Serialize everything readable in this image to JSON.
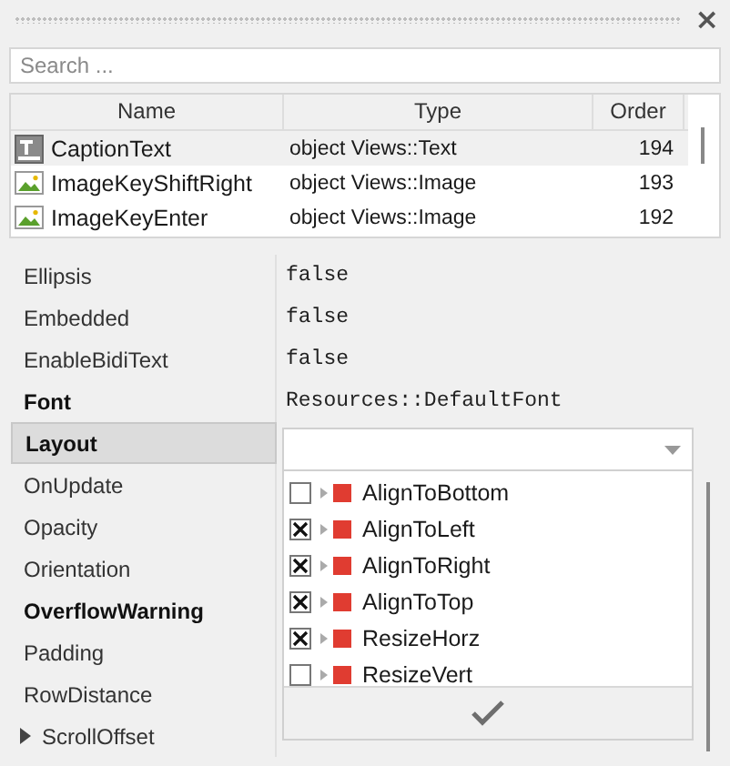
{
  "panel": {
    "close": "×"
  },
  "search": {
    "placeholder": "Search ..."
  },
  "table": {
    "columns": [
      "Name",
      "Type",
      "Order"
    ],
    "rows": [
      {
        "kind": "text",
        "name": "CaptionText",
        "type": "object Views::Text",
        "order": "194",
        "selected": true
      },
      {
        "kind": "image",
        "name": "ImageKeyShiftRight",
        "type": "object Views::Image",
        "order": "193",
        "selected": false
      },
      {
        "kind": "image",
        "name": "ImageKeyEnter",
        "type": "object Views::Image",
        "order": "192",
        "selected": false
      }
    ]
  },
  "properties": [
    {
      "name": "Ellipsis",
      "bold": false,
      "selected": false,
      "expandable": false,
      "value": "false"
    },
    {
      "name": "Embedded",
      "bold": false,
      "selected": false,
      "expandable": false,
      "value": "false"
    },
    {
      "name": "EnableBidiText",
      "bold": false,
      "selected": false,
      "expandable": false,
      "value": "false"
    },
    {
      "name": "Font",
      "bold": true,
      "selected": false,
      "expandable": false,
      "value": "Resources::DefaultFont"
    },
    {
      "name": "Layout",
      "bold": true,
      "selected": true,
      "expandable": false
    },
    {
      "name": "OnUpdate",
      "bold": false,
      "selected": false,
      "expandable": false
    },
    {
      "name": "Opacity",
      "bold": false,
      "selected": false,
      "expandable": false
    },
    {
      "name": "Orientation",
      "bold": false,
      "selected": false,
      "expandable": false
    },
    {
      "name": "OverflowWarning",
      "bold": true,
      "selected": false,
      "expandable": false
    },
    {
      "name": "Padding",
      "bold": false,
      "selected": false,
      "expandable": false
    },
    {
      "name": "RowDistance",
      "bold": false,
      "selected": false,
      "expandable": false
    },
    {
      "name": "ScrollOffset",
      "bold": false,
      "selected": false,
      "expandable": true
    }
  ],
  "flags_popup": {
    "items": [
      {
        "label": "AlignToBottom",
        "checked": false,
        "color": "#e03c31"
      },
      {
        "label": "AlignToLeft",
        "checked": true,
        "color": "#e03c31"
      },
      {
        "label": "AlignToRight",
        "checked": true,
        "color": "#e03c31"
      },
      {
        "label": "AlignToTop",
        "checked": true,
        "color": "#e03c31"
      },
      {
        "label": "ResizeHorz",
        "checked": true,
        "color": "#e03c31"
      },
      {
        "label": "ResizeVert",
        "checked": false,
        "color": "#e03c31"
      }
    ]
  }
}
